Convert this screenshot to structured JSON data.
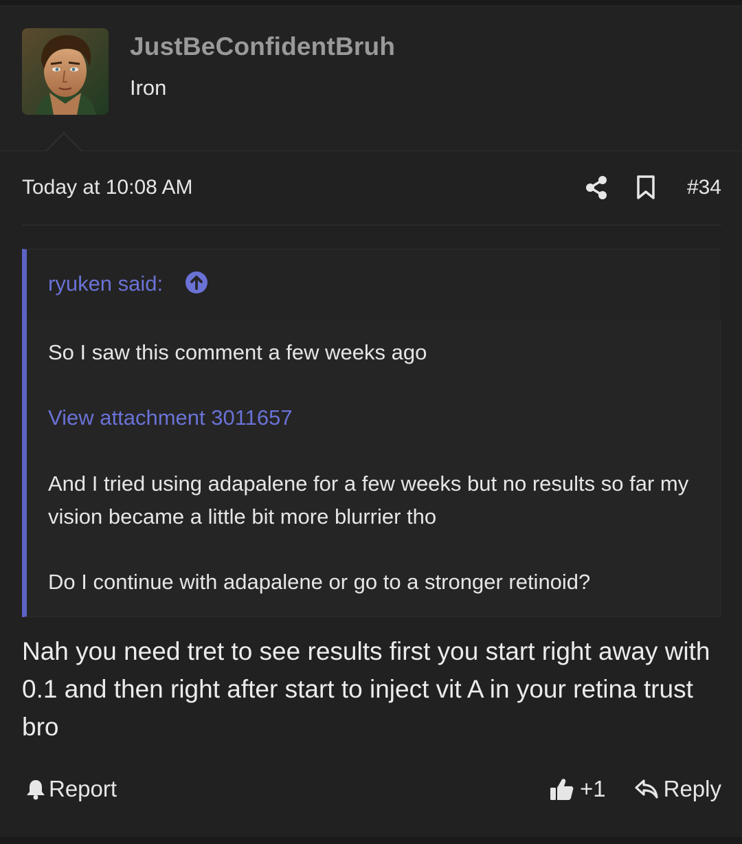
{
  "user": {
    "name": "JustBeConfidentBruh",
    "title": "Iron"
  },
  "post": {
    "timestamp": "Today at 10:08 AM",
    "number": "#34",
    "body": "Nah you need tret to see results first you start right away with 0.1 and then right after start to inject vit A in your retina trust bro"
  },
  "quote": {
    "author": "ryuken said:",
    "line1": "So I saw this comment a few weeks ago",
    "attachment": "View attachment 3011657",
    "line2": "And I tried using adapalene for a few weeks but no results so far my vision became a little bit more blurrier tho",
    "line3": "Do I continue with adapalene or go to a stronger retinoid?"
  },
  "actions": {
    "report": "Report",
    "like_count": "+1",
    "reply": "Reply"
  },
  "colors": {
    "background": "#212121",
    "accent": "#6a72d6",
    "quote_bar": "#5c63c4",
    "username": "#9a9a9a"
  }
}
